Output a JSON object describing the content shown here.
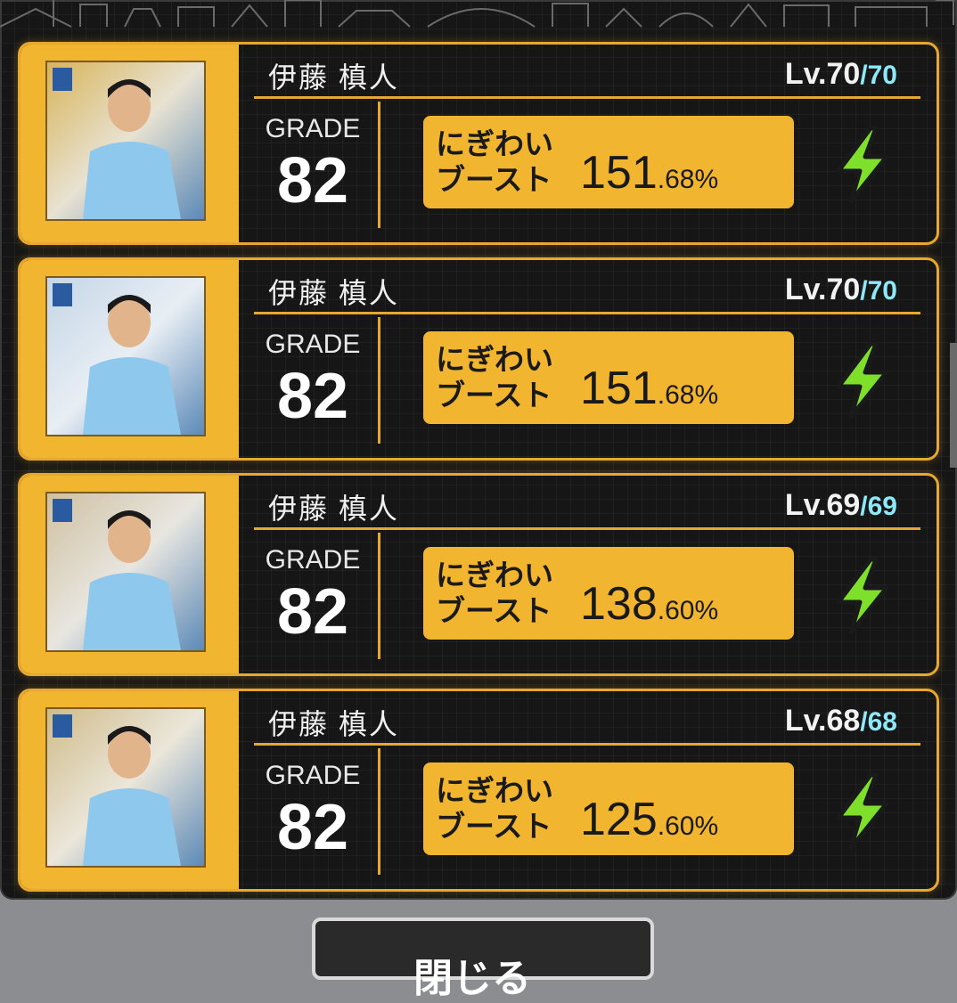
{
  "cards": [
    {
      "name": "伊藤 槙人",
      "level": "Lv.70",
      "level_max": "/70",
      "grade_label": "GRADE",
      "grade": "82",
      "boost_label_line1": "にぎわい",
      "boost_label_line2": "ブースト",
      "boost_int": "151",
      "boost_dec": ".68%",
      "icon": "lightning-bolt-icon"
    },
    {
      "name": "伊藤 槙人",
      "level": "Lv.70",
      "level_max": "/70",
      "grade_label": "GRADE",
      "grade": "82",
      "boost_label_line1": "にぎわい",
      "boost_label_line2": "ブースト",
      "boost_int": "151",
      "boost_dec": ".68%",
      "icon": "lightning-bolt-icon"
    },
    {
      "name": "伊藤 槙人",
      "level": "Lv.69",
      "level_max": "/69",
      "grade_label": "GRADE",
      "grade": "82",
      "boost_label_line1": "にぎわい",
      "boost_label_line2": "ブースト",
      "boost_int": "138",
      "boost_dec": ".60%",
      "icon": "lightning-bolt-icon"
    },
    {
      "name": "伊藤 槙人",
      "level": "Lv.68",
      "level_max": "/68",
      "grade_label": "GRADE",
      "grade": "82",
      "boost_label_line1": "にぎわい",
      "boost_label_line2": "ブースト",
      "boost_int": "125",
      "boost_dec": ".60%",
      "icon": "lightning-bolt-icon"
    }
  ],
  "bottom_button": {
    "label": "閉じる"
  },
  "colors": {
    "accent": "#f2b52f",
    "level_max": "#8ee8f8",
    "bolt": "#7ee02a"
  }
}
